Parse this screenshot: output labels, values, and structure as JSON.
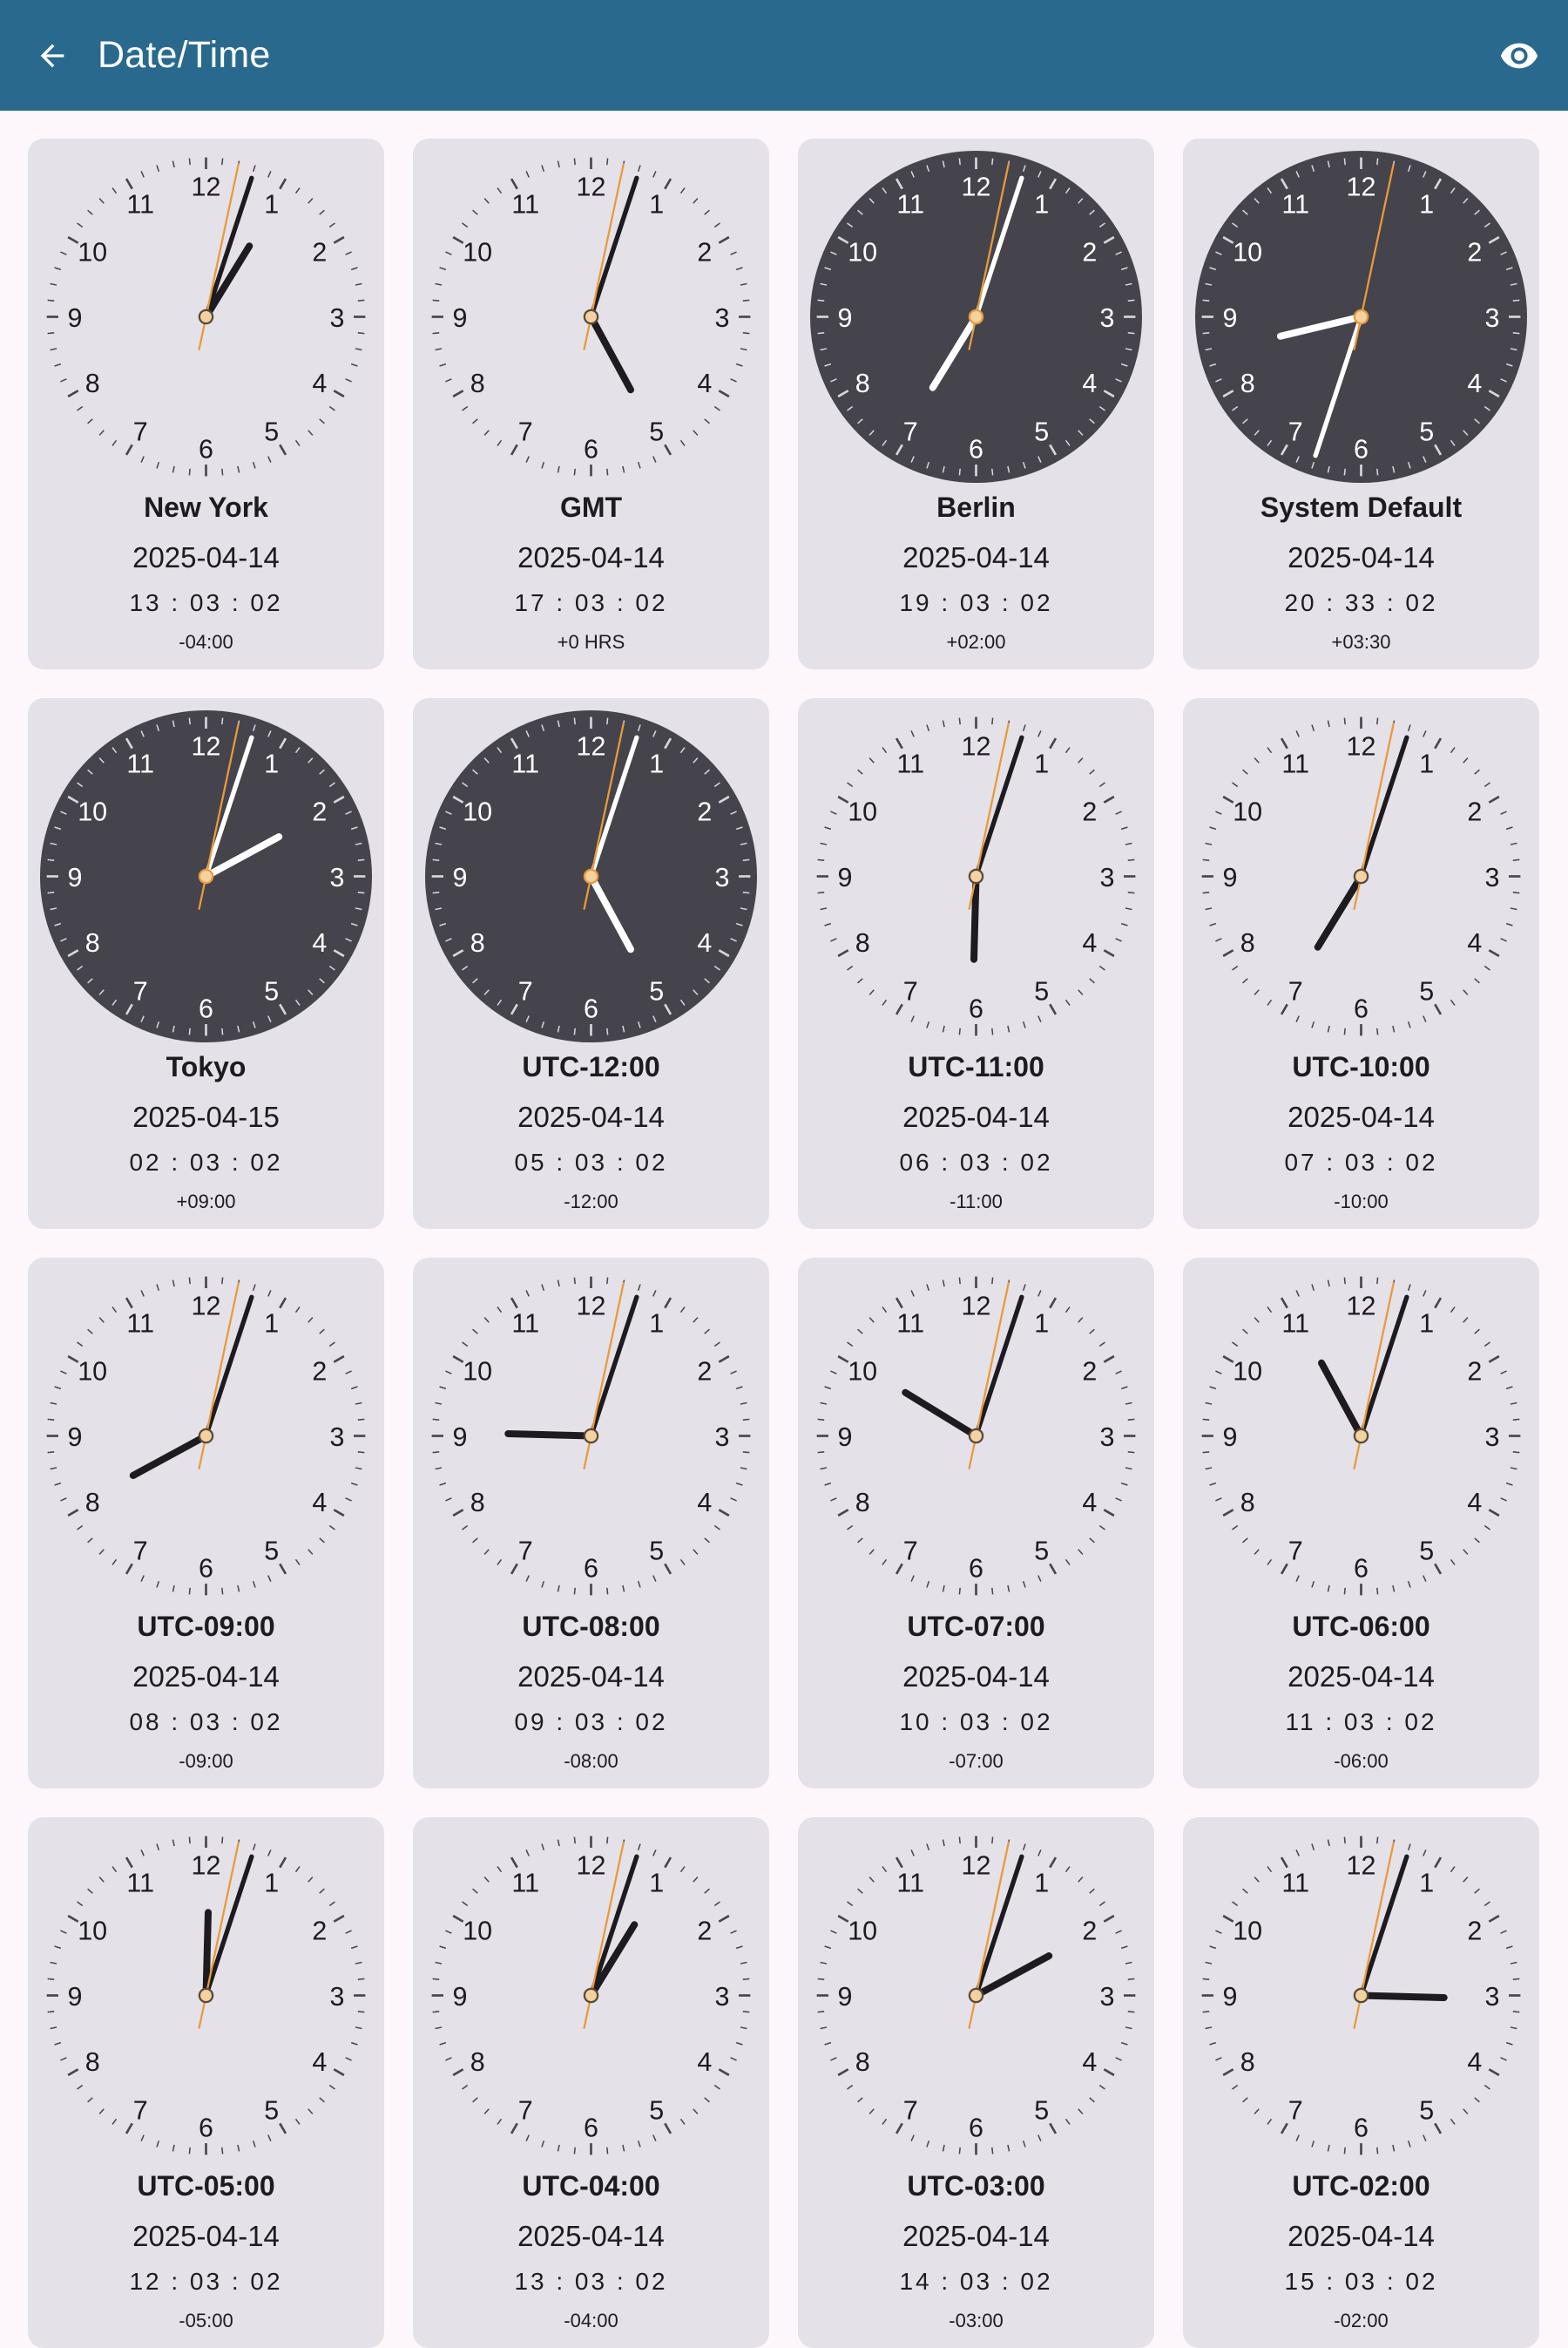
{
  "app_bar": {
    "title": "Date/Time",
    "back_icon": "arrow-back-icon",
    "action_icon": "eye-icon",
    "color": "#29698d"
  },
  "clocks": [
    {
      "city": "New York",
      "date": "2025-04-14",
      "time": "13:03:02",
      "offset": "-04:00",
      "theme": "light"
    },
    {
      "city": "GMT",
      "date": "2025-04-14",
      "time": "17:03:02",
      "offset": "+0 HRS",
      "theme": "light"
    },
    {
      "city": "Berlin",
      "date": "2025-04-14",
      "time": "19:03:02",
      "offset": "+02:00",
      "theme": "dark"
    },
    {
      "city": "System Default",
      "date": "2025-04-14",
      "time": "20:33:02",
      "offset": "+03:30",
      "theme": "dark"
    },
    {
      "city": "Tokyo",
      "date": "2025-04-15",
      "time": "02:03:02",
      "offset": "+09:00",
      "theme": "dark"
    },
    {
      "city": "UTC-12:00",
      "date": "2025-04-14",
      "time": "05:03:02",
      "offset": "-12:00",
      "theme": "dark"
    },
    {
      "city": "UTC-11:00",
      "date": "2025-04-14",
      "time": "06:03:02",
      "offset": "-11:00",
      "theme": "light"
    },
    {
      "city": "UTC-10:00",
      "date": "2025-04-14",
      "time": "07:03:02",
      "offset": "-10:00",
      "theme": "light"
    },
    {
      "city": "UTC-09:00",
      "date": "2025-04-14",
      "time": "08:03:02",
      "offset": "-09:00",
      "theme": "light"
    },
    {
      "city": "UTC-08:00",
      "date": "2025-04-14",
      "time": "09:03:02",
      "offset": "-08:00",
      "theme": "light"
    },
    {
      "city": "UTC-07:00",
      "date": "2025-04-14",
      "time": "10:03:02",
      "offset": "-07:00",
      "theme": "light"
    },
    {
      "city": "UTC-06:00",
      "date": "2025-04-14",
      "time": "11:03:02",
      "offset": "-06:00",
      "theme": "light"
    },
    {
      "city": "UTC-05:00",
      "date": "2025-04-14",
      "time": "12:03:02",
      "offset": "-05:00",
      "theme": "light"
    },
    {
      "city": "UTC-04:00",
      "date": "2025-04-14",
      "time": "13:03:02",
      "offset": "-04:00",
      "theme": "light"
    },
    {
      "city": "UTC-03:00",
      "date": "2025-04-14",
      "time": "14:03:02",
      "offset": "-03:00",
      "theme": "light"
    },
    {
      "city": "UTC-02:00",
      "date": "2025-04-14",
      "time": "15:03:02",
      "offset": "-02:00",
      "theme": "light"
    }
  ],
  "colors": {
    "card_bg": "#e4e1e8",
    "dark_face": "#45434c",
    "second_hand": "#e89a3c",
    "page_bg": "#fdf7fc"
  }
}
